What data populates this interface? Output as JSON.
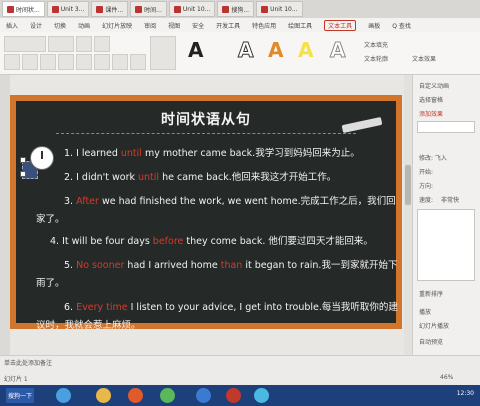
{
  "tabs": [
    {
      "label": "时间状..."
    },
    {
      "label": "Unit 3..."
    },
    {
      "label": "课件..."
    },
    {
      "label": "时间..."
    },
    {
      "label": "Unit 10..."
    },
    {
      "label": "搜狗..."
    },
    {
      "label": "Unit 10..."
    }
  ],
  "menu": {
    "items": [
      "插入",
      "设计",
      "切换",
      "动画",
      "幻灯片放映",
      "审阅",
      "视图",
      "安全",
      "开发工具",
      "特色应用",
      "绘图工具",
      "文本工具",
      "画板",
      "Q 查找"
    ],
    "active": "文本工具"
  },
  "toolbar": {
    "a_labels": [
      "A",
      "A",
      "A",
      "A",
      "A"
    ],
    "fill_label": "文本填充",
    "outline_label": "文本轮廓",
    "effect_label": "文本效果"
  },
  "slide": {
    "title": "时间状语从句",
    "lines": [
      {
        "num": "1.",
        "pre": " I learned ",
        "red": "until",
        "post": " my mother came back.我学习到妈妈回来为止。"
      },
      {
        "num": "2.",
        "pre": " I didn't work ",
        "red": "until",
        "post": " he came back.他回来我这才开始工作。"
      },
      {
        "num": "3.",
        "pre": " ",
        "red": "After",
        "post": " we had finished the work, we went home.完成工作之后，我们回"
      },
      {
        "num": "",
        "pre": "家了。",
        "red": "",
        "post": ""
      },
      {
        "num": "4.",
        "pre": " It will be four days ",
        "red": "before",
        "post": " they come back. 他们要过四天才能回来。"
      },
      {
        "num": "5.",
        "pre": " ",
        "red": "No sooner",
        "post": " had I arrived home "
      },
      {
        "num": "",
        "pre": "",
        "red": "",
        "post": ""
      },
      {
        "num": "6.",
        "pre": " ",
        "red": "Every time",
        "post": " I listen to your advice, I get into trouble.每当我听取你的建"
      },
      {
        "num": "",
        "pre": "议时，我就会惹上麻烦。",
        "red": "",
        "post": ""
      }
    ],
    "line5_than": "than",
    "line5_tail": " it began to rain.我一到家就开始下",
    "line5_cont": "雨了。"
  },
  "right_panel": {
    "header": "自定义动画",
    "select_pane": "选择窗格",
    "add_effect": "添加效果",
    "modify_label": "修改: 飞入",
    "start_label": "开始:",
    "direction_label": "方向:",
    "speed_label": "速度:",
    "speed_value": "非常快",
    "reorder": "重新排序",
    "play": "播放",
    "preview": "幻灯片播放",
    "auto_preview": "自动预览"
  },
  "status": {
    "notes": "单击此处添加备注",
    "slide_num": "幻灯片 1",
    "zoom": "46%"
  },
  "taskbar": {
    "start": "搜狗一下",
    "time": "12:30"
  },
  "colors": {
    "accent": "#c0392b",
    "frame": "#d1742c",
    "board": "#252a28",
    "keyword": "#d83a2b"
  }
}
